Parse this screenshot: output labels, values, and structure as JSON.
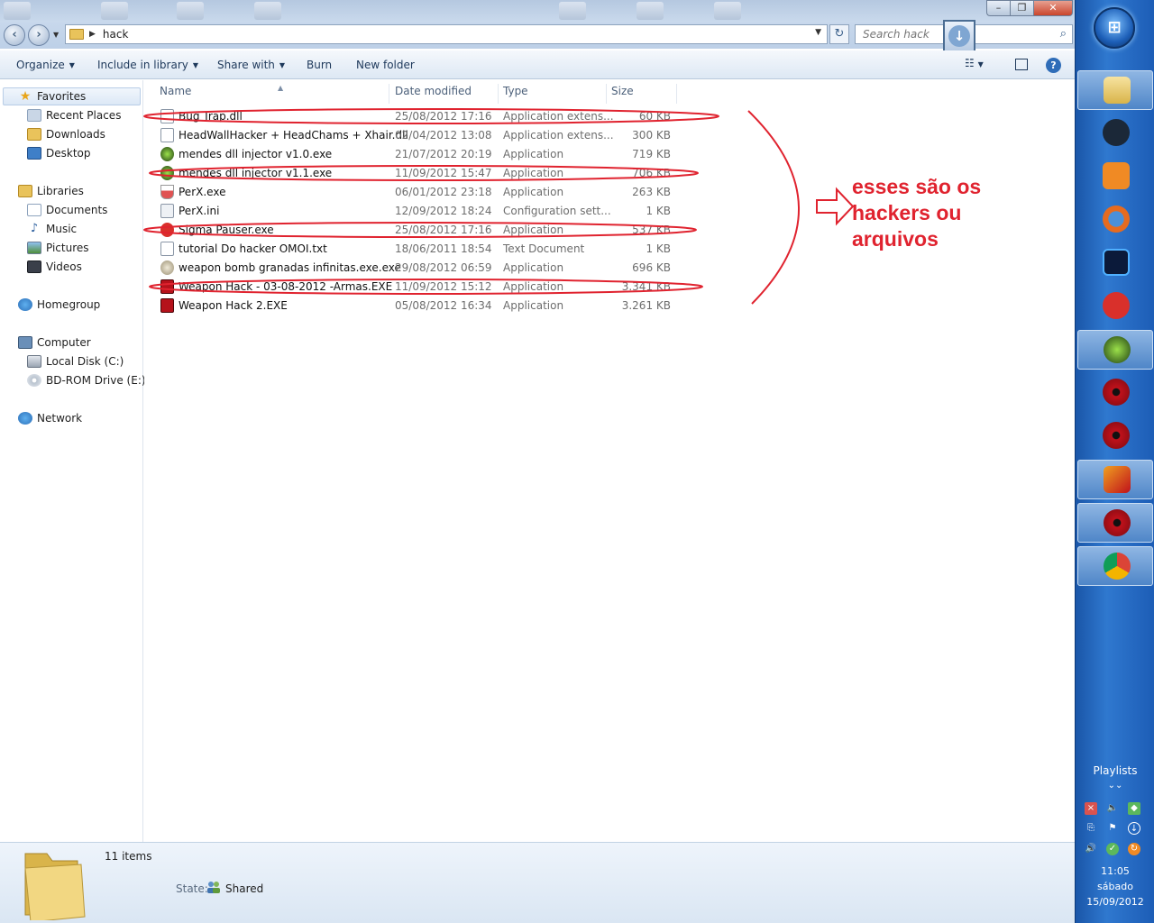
{
  "window": {
    "address_path": "hack",
    "search_placeholder": "Search hack",
    "controls": {
      "minimize": "–",
      "maximize": "❐",
      "close": "✕"
    }
  },
  "toolbar": {
    "organize": "Organize",
    "include_in_library": "Include in library",
    "share_with": "Share with",
    "burn": "Burn",
    "new_folder": "New folder"
  },
  "navpane": {
    "favorites": {
      "label": "Favorites",
      "items": [
        "Recent Places",
        "Downloads",
        "Desktop"
      ]
    },
    "libraries": {
      "label": "Libraries",
      "items": [
        "Documents",
        "Music",
        "Pictures",
        "Videos"
      ]
    },
    "homegroup": "Homegroup",
    "computer": {
      "label": "Computer",
      "items": [
        "Local Disk (C:)",
        "BD-ROM Drive (E:)"
      ]
    },
    "network": "Network"
  },
  "columns": {
    "name": "Name",
    "date": "Date modified",
    "type": "Type",
    "size": "Size"
  },
  "files": [
    {
      "name": "Bug Trap.dll",
      "date": "25/08/2012 17:16",
      "type": "Application extens...",
      "size": "60 KB",
      "icon": "dll-icon",
      "circled": true
    },
    {
      "name": "HeadWallHacker + HeadChams + Xhair.dll",
      "date": "02/04/2012 13:08",
      "type": "Application extens...",
      "size": "300 KB",
      "icon": "dll-icon",
      "circled": false
    },
    {
      "name": "mendes dll injector v1.0.exe",
      "date": "21/07/2012 20:19",
      "type": "Application",
      "size": "719 KB",
      "icon": "mendes-icon",
      "circled": false
    },
    {
      "name": "mendes dll injector v1.1.exe",
      "date": "11/09/2012 15:47",
      "type": "Application",
      "size": "706 KB",
      "icon": "mendes-icon",
      "circled": true
    },
    {
      "name": "PerX.exe",
      "date": "06/01/2012 23:18",
      "type": "Application",
      "size": "263 KB",
      "icon": "flask-icon",
      "circled": false
    },
    {
      "name": "PerX.ini",
      "date": "12/09/2012 18:24",
      "type": "Configuration sett...",
      "size": "1 KB",
      "icon": "ini-icon",
      "circled": false
    },
    {
      "name": "Sigma Pauser.exe",
      "date": "25/08/2012 17:16",
      "type": "Application",
      "size": "537 KB",
      "icon": "sigma-icon",
      "circled": true
    },
    {
      "name": "tutorial Do hacker  OMOI.txt",
      "date": "18/06/2011 18:54",
      "type": "Text Document",
      "size": "1 KB",
      "icon": "txt-icon",
      "circled": false
    },
    {
      "name": "weapon bomb granadas infinitas.exe.exe",
      "date": "29/08/2012 06:59",
      "type": "Application",
      "size": "696 KB",
      "icon": "skull-icon",
      "circled": false
    },
    {
      "name": "Weapon Hack - 03-08-2012 -Armas.EXE",
      "date": "11/09/2012 15:12",
      "type": "Application",
      "size": "3.341 KB",
      "icon": "weapon-icon",
      "circled": true
    },
    {
      "name": "Weapon Hack 2.EXE",
      "date": "05/08/2012 16:34",
      "type": "Application",
      "size": "3.261 KB",
      "icon": "weapon-icon",
      "circled": false
    }
  ],
  "annotation": {
    "text": "esses são os hackers ou arquivos",
    "color": "#e0232f"
  },
  "details": {
    "item_count": "11 items",
    "state_label": "State:",
    "state_value": "Shared"
  },
  "taskbar": {
    "buttons": [
      "explorer-icon",
      "steam-icon",
      "media-player-icon",
      "firefox-icon",
      "pb-icon",
      "sigma-icon",
      "mendes-icon",
      "sharingan-icon",
      "sharingan-icon",
      "z-icon",
      "sharingan-icon",
      "chrome-icon"
    ],
    "playlists": "Playlists",
    "time": "11:05",
    "day": "sábado",
    "date": "15/09/2012"
  },
  "colors": {
    "accent": "#1e395b",
    "annotation_red": "#e0232f",
    "taskbar_blue": "#2f78cf"
  }
}
